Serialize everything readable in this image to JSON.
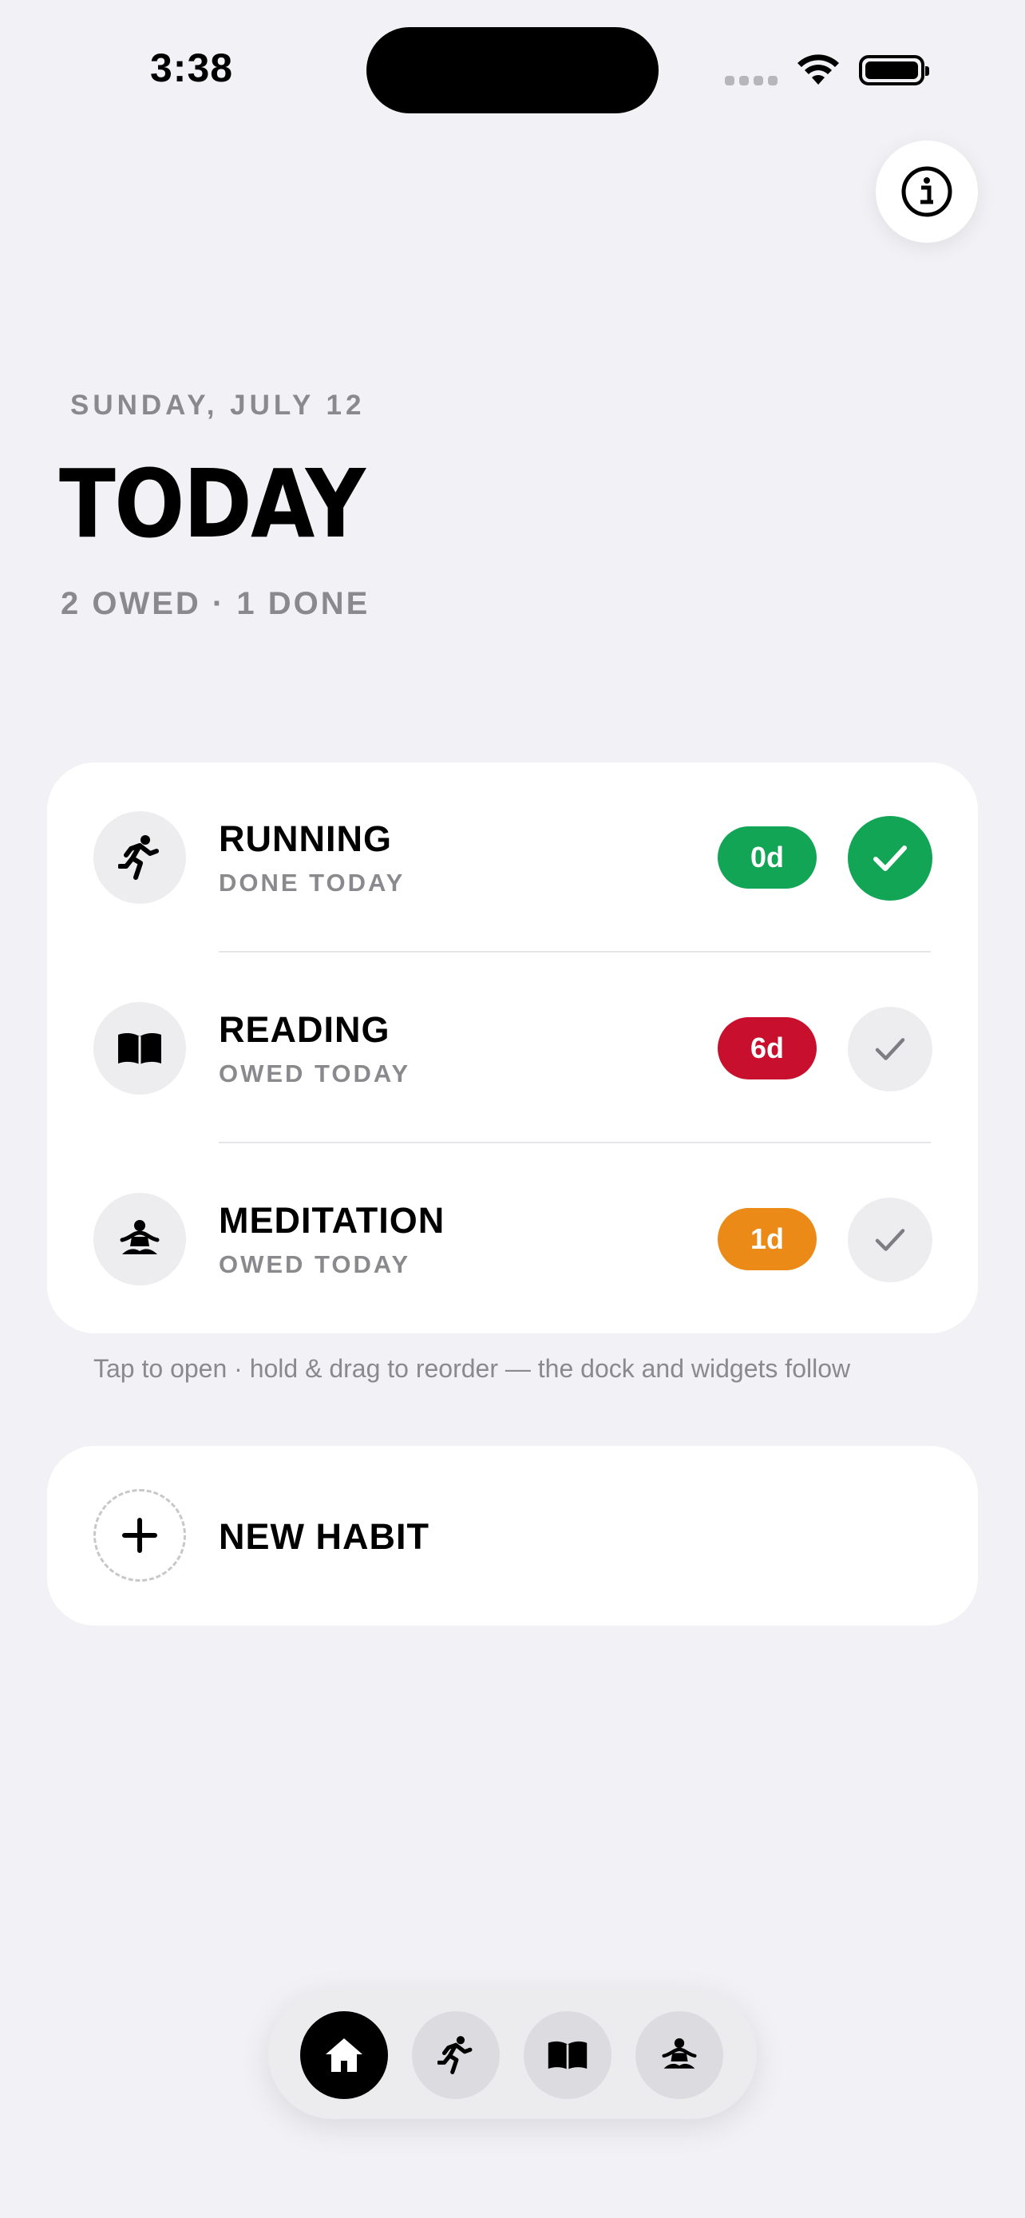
{
  "status_bar": {
    "time": "3:38"
  },
  "header": {
    "date": "SUNDAY, JULY 12",
    "title": "TODAY",
    "summary": "2 OWED · 1 DONE"
  },
  "habits": [
    {
      "name": "RUNNING",
      "status": "DONE TODAY",
      "badge": "0d",
      "badge_color": "#13a556",
      "icon": "running-icon",
      "done": true
    },
    {
      "name": "READING",
      "status": "OWED TODAY",
      "badge": "6d",
      "badge_color": "#c8102e",
      "icon": "book-icon",
      "done": false
    },
    {
      "name": "MEDITATION",
      "status": "OWED TODAY",
      "badge": "1d",
      "badge_color": "#eb8a17",
      "icon": "meditation-icon",
      "done": false
    }
  ],
  "hint": "Tap to open · hold & drag to reorder — the dock and widgets follow",
  "new_habit": {
    "label": "NEW HABIT"
  },
  "dock": {
    "items": [
      {
        "icon": "home-icon",
        "active": true
      },
      {
        "icon": "running-icon",
        "active": false
      },
      {
        "icon": "book-icon",
        "active": false
      },
      {
        "icon": "meditation-icon",
        "active": false
      }
    ]
  },
  "colors": {
    "done_green": "#13a556",
    "background": "#f2f2f6"
  }
}
